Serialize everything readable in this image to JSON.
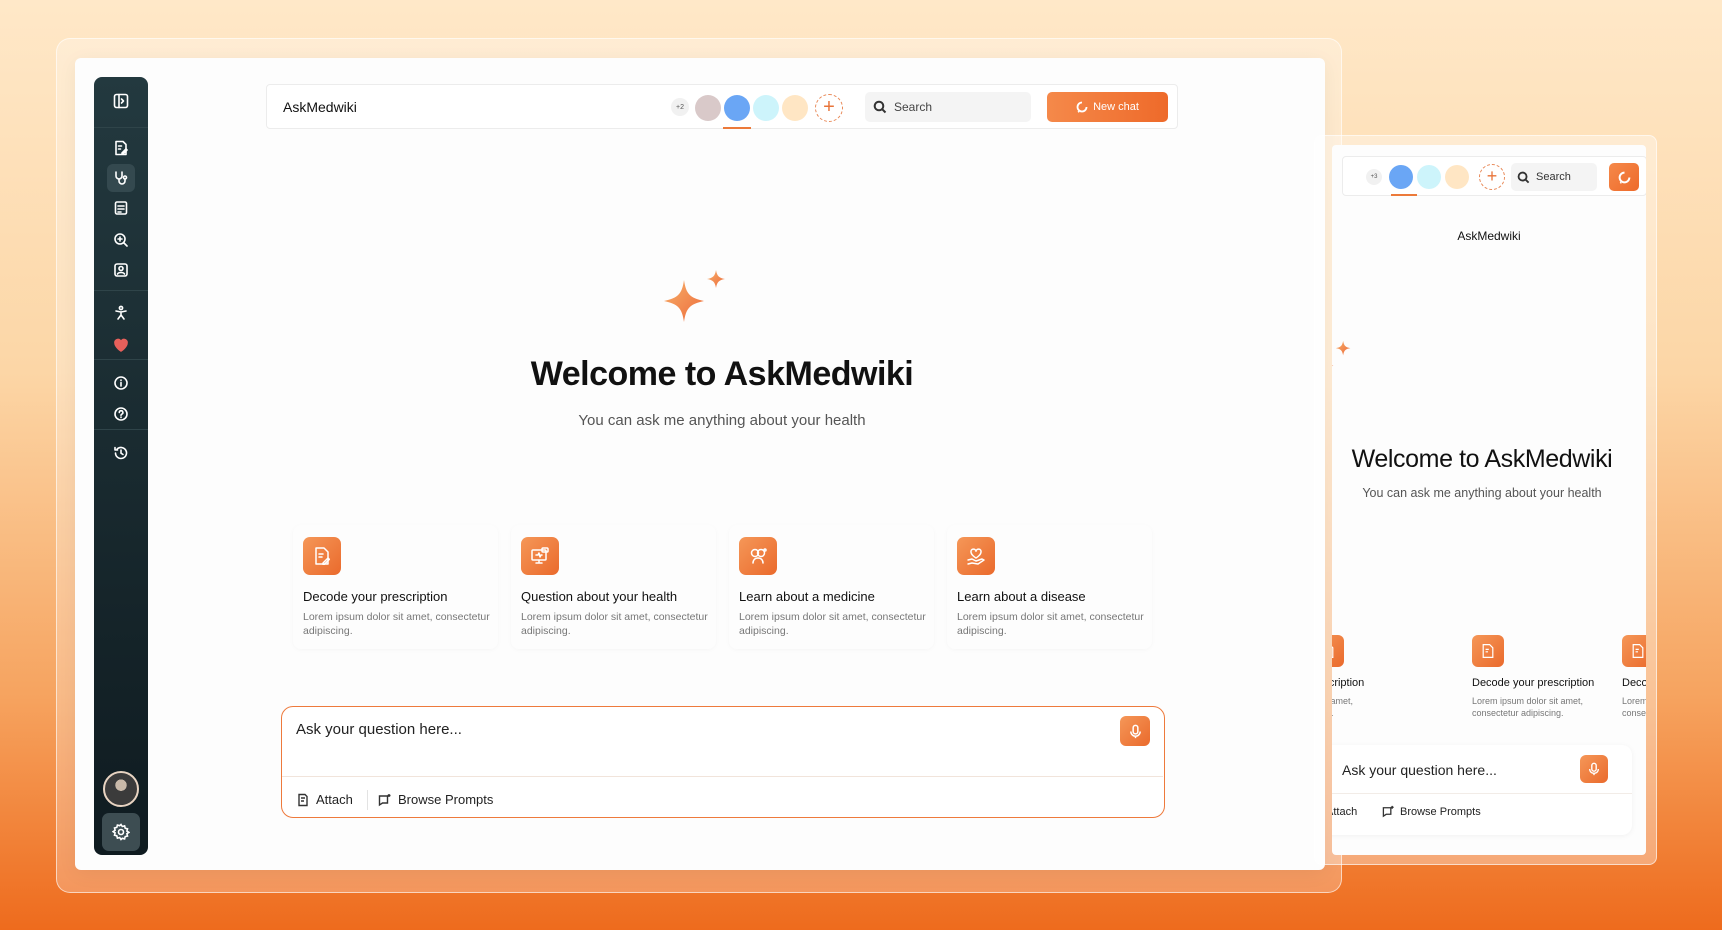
{
  "app": {
    "title": "AskMedwiki"
  },
  "header": {
    "member_count": "+2",
    "avatar_colors": [
      "#d9c9c9",
      "#6aa6f5",
      "#cdf4fb",
      "#ffe6c4"
    ],
    "search_placeholder": "Search",
    "new_chat_label": "New chat"
  },
  "sidebar": {
    "items": [
      {
        "name": "toggle-sidebar-icon"
      },
      {
        "name": "prescription-icon"
      },
      {
        "name": "stethoscope-icon",
        "active": true
      },
      {
        "name": "report-icon"
      },
      {
        "name": "medicine-search-icon"
      },
      {
        "name": "profile-icon"
      },
      {
        "name": "body-icon"
      },
      {
        "name": "heart-icon"
      },
      {
        "name": "info-icon"
      },
      {
        "name": "help-icon"
      },
      {
        "name": "history-icon"
      },
      {
        "name": "settings-icon"
      }
    ]
  },
  "hero": {
    "welcome": "Welcome to  AskMedwiki",
    "subtitle": "You can ask me anything about your health"
  },
  "cards": [
    {
      "title": "Decode your prescription",
      "desc": "Lorem ipsum dolor sit amet, consectetur adipiscing.",
      "icon": "prescription-icon"
    },
    {
      "title": "Question about your health",
      "desc": "Lorem ipsum dolor sit amet, consectetur adipiscing.",
      "icon": "monitor-health-icon"
    },
    {
      "title": "Learn about a medicine",
      "desc": "Lorem ipsum dolor sit amet, consectetur adipiscing.",
      "icon": "medicine-icon"
    },
    {
      "title": "Learn about a disease",
      "desc": "Lorem ipsum dolor sit amet, consectetur adipiscing.",
      "icon": "heart-hand-icon"
    }
  ],
  "composer": {
    "placeholder": "Ask your question here...",
    "attach_label": "Attach",
    "browse_label": "Browse Prompts"
  },
  "preview": {
    "member_count": "+3",
    "search_label": "Search",
    "title": "AskMedwiki",
    "welcome": "Welcome to  AskMedwiki",
    "subtitle": "You can ask me anything about your health",
    "cards": [
      {
        "title": "Decode your prescription",
        "desc": "Lorem ipsum dolor sit amet, consectetur adipiscing."
      },
      {
        "title": "Decode your prescription",
        "desc": "Lorem ipsum dolor sit amet, consectetur adipiscing."
      },
      {
        "title": "Decode your prescription",
        "desc": "Lorem ipsum dolor sit amet, consectetur adipiscing."
      }
    ],
    "ask_text": "Ask your question here...",
    "attach_label": "Attach",
    "browse_label": "Browse Prompts"
  }
}
